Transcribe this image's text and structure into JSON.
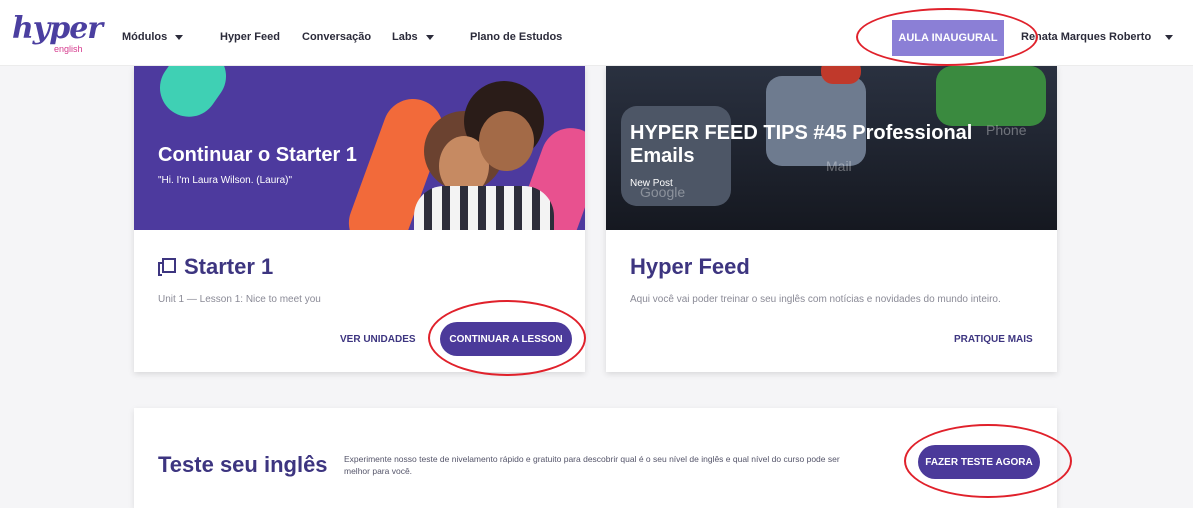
{
  "header": {
    "logo_main": "hyper",
    "logo_sub": "english",
    "nav": [
      {
        "label": "Módulos",
        "has_dropdown": true
      },
      {
        "label": "Hyper Feed",
        "has_dropdown": false
      },
      {
        "label": "Conversação",
        "has_dropdown": false
      },
      {
        "label": "Labs",
        "has_dropdown": true
      },
      {
        "label": "Plano de Estudos",
        "has_dropdown": false
      }
    ],
    "cta_label": "AULA INAUGURAL",
    "user_name": "Renata Marques Roberto"
  },
  "card_starter": {
    "hero_title": "Continuar o Starter 1",
    "hero_subtitle": "\"Hi. I'm Laura Wilson. (Laura)\"",
    "title": "Starter 1",
    "icon": "book-number-icon",
    "description": "Unit 1 — Lesson 1: Nice to meet you",
    "secondary_action": "VER UNIDADES",
    "primary_action": "CONTINUAR A LESSON"
  },
  "card_feed": {
    "hero_title": "HYPER FEED TIPS #45 Professional Emails",
    "hero_subtitle": "New Post",
    "hero_app_labels": [
      "Mail",
      "Google",
      "Phone"
    ],
    "title": "Hyper Feed",
    "description": "Aqui você vai poder treinar o seu inglês com notícias e novidades do mundo inteiro.",
    "action": "PRATIQUE MAIS"
  },
  "banner": {
    "title": "Teste seu inglês",
    "description": "Experimente nosso teste de nivelamento rápido e gratuito para descobrir qual é o seu nível de inglês e qual nível do curso pode ser melhor para você.",
    "action": "FAZER TESTE AGORA"
  },
  "colors": {
    "brand": "#4b3a9a",
    "cta": "#8b7fd6",
    "annotation": "#e0212b"
  }
}
